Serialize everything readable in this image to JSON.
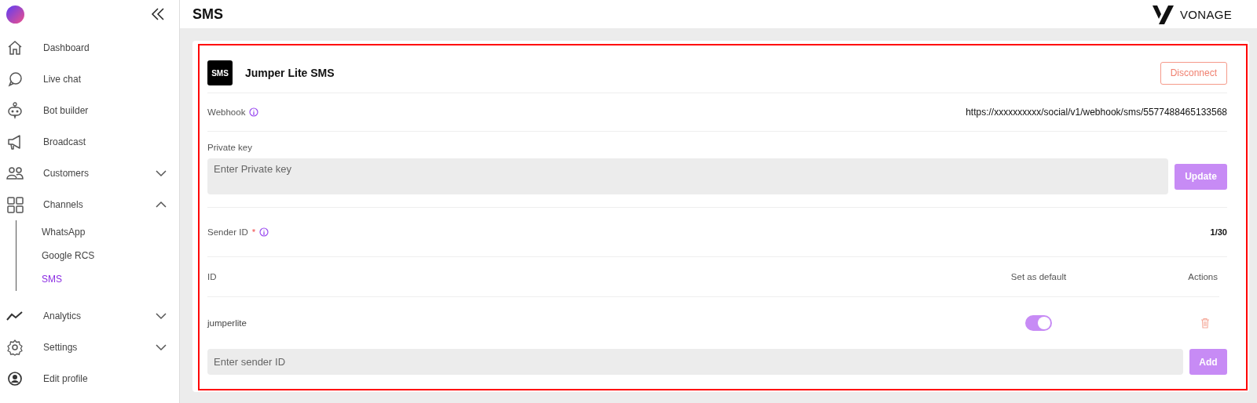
{
  "sidebar": {
    "items": [
      {
        "label": "Dashboard"
      },
      {
        "label": "Live chat"
      },
      {
        "label": "Bot builder"
      },
      {
        "label": "Broadcast"
      },
      {
        "label": "Customers",
        "expanded": false
      },
      {
        "label": "Channels",
        "expanded": true,
        "children": [
          {
            "label": "WhatsApp",
            "selected": false
          },
          {
            "label": "Google RCS",
            "selected": false
          },
          {
            "label": "SMS",
            "selected": true
          }
        ]
      },
      {
        "label": "Analytics",
        "expanded": false
      },
      {
        "label": "Settings",
        "expanded": false
      },
      {
        "label": "Edit profile"
      }
    ]
  },
  "header": {
    "title": "SMS",
    "brand": "VONAGE"
  },
  "card": {
    "logo": "SMS",
    "title": "Jumper Lite SMS",
    "disconnect": "Disconnect",
    "webhook": {
      "label": "Webhook",
      "value": "https://xxxxxxxxxx/social/v1/webhook/sms/5577488465133568"
    },
    "private_key": {
      "label": "Private key",
      "placeholder": "Enter Private key",
      "button": "Update"
    },
    "sender": {
      "label": "Sender ID",
      "required": "*",
      "count": "1/30"
    },
    "table": {
      "columns": [
        "ID",
        "Set as default",
        "Actions"
      ],
      "rows": [
        {
          "id": "jumperlite",
          "default": true
        }
      ]
    },
    "new_sender": {
      "placeholder": "Enter sender ID",
      "button": "Add"
    }
  }
}
